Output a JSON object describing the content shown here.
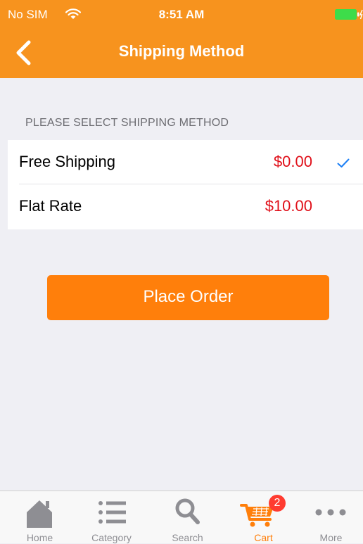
{
  "status_bar": {
    "carrier": "No SIM",
    "time": "8:51 AM"
  },
  "nav": {
    "title": "Shipping Method",
    "back_icon": "chevron-left-icon"
  },
  "section": {
    "header": "PLEASE SELECT SHIPPING METHOD"
  },
  "shipping_options": [
    {
      "name": "Free Shipping",
      "price": "$0.00",
      "selected": true
    },
    {
      "name": "Flat Rate",
      "price": "$10.00",
      "selected": false
    }
  ],
  "place_order": {
    "label": "Place Order"
  },
  "tab_bar": {
    "tabs": [
      {
        "label": "Home",
        "icon": "home-icon",
        "active": false
      },
      {
        "label": "Category",
        "icon": "list-icon",
        "active": false
      },
      {
        "label": "Search",
        "icon": "search-icon",
        "active": false
      },
      {
        "label": "Cart",
        "icon": "cart-icon",
        "active": true,
        "badge": "2"
      },
      {
        "label": "More",
        "icon": "more-icon",
        "active": false
      }
    ]
  },
  "colors": {
    "header": "#f7931e",
    "button": "#ff7f0b",
    "price": "#e0101a",
    "check": "#1a7ef5",
    "badge": "#ff3b30",
    "tab_inactive": "#8e8e93",
    "tab_active": "#ff7f0b"
  }
}
